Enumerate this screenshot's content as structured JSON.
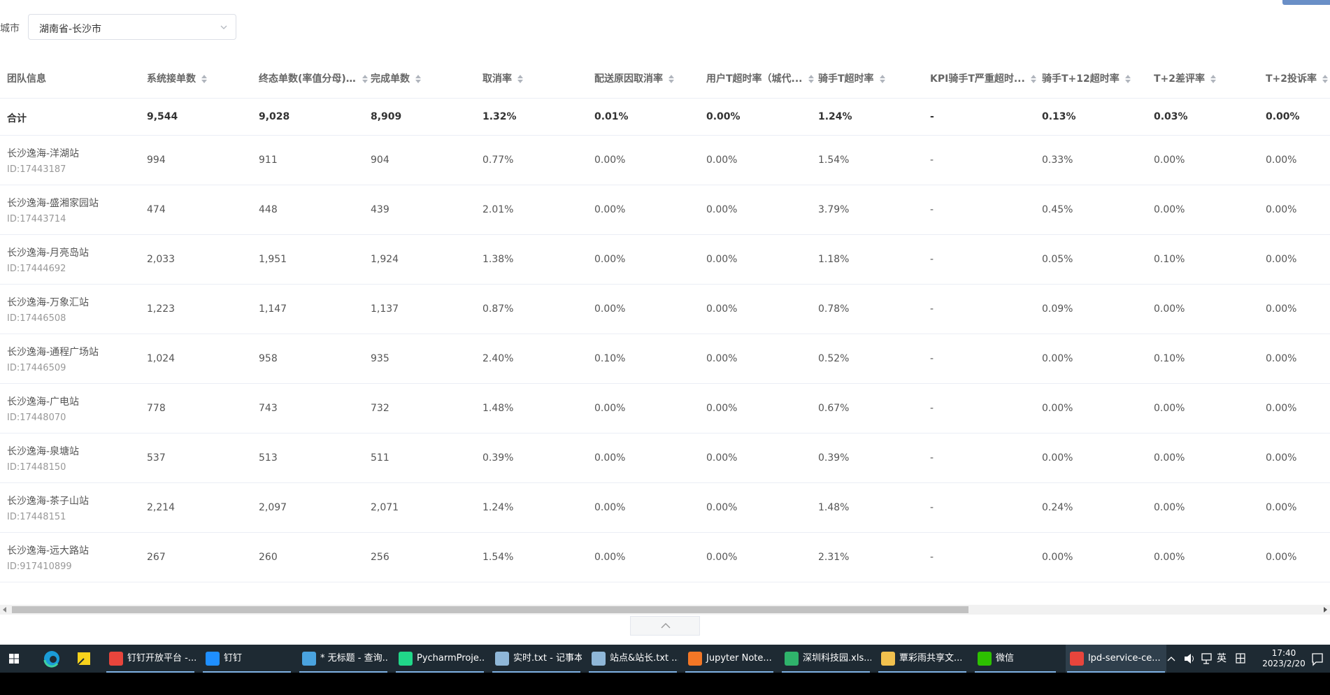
{
  "filter": {
    "label": "城市",
    "value": "湖南省-长沙市"
  },
  "table": {
    "columns": [
      {
        "label": "团队信息",
        "sortable": false
      },
      {
        "label": "系统接单数",
        "sortable": true
      },
      {
        "label": "终态单数(率值分母)...",
        "sortable": true
      },
      {
        "label": "完成单数",
        "sortable": true
      },
      {
        "label": "取消率",
        "sortable": true
      },
      {
        "label": "配送原因取消率",
        "sortable": true
      },
      {
        "label": "用户T超时率（城代...",
        "sortable": true
      },
      {
        "label": "骑手T超时率",
        "sortable": true
      },
      {
        "label": "KPI骑手T严重超时...",
        "sortable": true
      },
      {
        "label": "骑手T+12超时率",
        "sortable": true
      },
      {
        "label": "T+2差评率",
        "sortable": true
      },
      {
        "label": "T+2投诉率",
        "sortable": true
      }
    ],
    "total": [
      "合计",
      "9,544",
      "9,028",
      "8,909",
      "1.32%",
      "0.01%",
      "0.00%",
      "1.24%",
      "-",
      "0.13%",
      "0.03%",
      "0.00%"
    ],
    "rows": [
      {
        "name": "长沙逸海-洋湖站",
        "id": "ID:17443187",
        "values": [
          "994",
          "911",
          "904",
          "0.77%",
          "0.00%",
          "0.00%",
          "1.54%",
          "-",
          "0.33%",
          "0.00%",
          "0.00%"
        ]
      },
      {
        "name": "长沙逸海-盛湘家园站",
        "id": "ID:17443714",
        "values": [
          "474",
          "448",
          "439",
          "2.01%",
          "0.00%",
          "0.00%",
          "3.79%",
          "-",
          "0.45%",
          "0.00%",
          "0.00%"
        ]
      },
      {
        "name": "长沙逸海-月亮岛站",
        "id": "ID:17444692",
        "values": [
          "2,033",
          "1,951",
          "1,924",
          "1.38%",
          "0.00%",
          "0.00%",
          "1.18%",
          "-",
          "0.05%",
          "0.10%",
          "0.00%"
        ]
      },
      {
        "name": "长沙逸海-万象汇站",
        "id": "ID:17446508",
        "values": [
          "1,223",
          "1,147",
          "1,137",
          "0.87%",
          "0.00%",
          "0.00%",
          "0.78%",
          "-",
          "0.09%",
          "0.00%",
          "0.00%"
        ]
      },
      {
        "name": "长沙逸海-通程广场站",
        "id": "ID:17446509",
        "values": [
          "1,024",
          "958",
          "935",
          "2.40%",
          "0.10%",
          "0.00%",
          "0.52%",
          "-",
          "0.00%",
          "0.10%",
          "0.00%"
        ]
      },
      {
        "name": "长沙逸海-广电站",
        "id": "ID:17448070",
        "values": [
          "778",
          "743",
          "732",
          "1.48%",
          "0.00%",
          "0.00%",
          "0.67%",
          "-",
          "0.00%",
          "0.00%",
          "0.00%"
        ]
      },
      {
        "name": "长沙逸海-泉塘站",
        "id": "ID:17448150",
        "values": [
          "537",
          "513",
          "511",
          "0.39%",
          "0.00%",
          "0.00%",
          "0.39%",
          "-",
          "0.00%",
          "0.00%",
          "0.00%"
        ]
      },
      {
        "name": "长沙逸海-茶子山站",
        "id": "ID:17448151",
        "values": [
          "2,214",
          "2,097",
          "2,071",
          "1.24%",
          "0.00%",
          "0.00%",
          "1.48%",
          "-",
          "0.24%",
          "0.00%",
          "0.00%"
        ]
      },
      {
        "name": "长沙逸海-远大路站",
        "id": "ID:917410899",
        "values": [
          "267",
          "260",
          "256",
          "1.54%",
          "0.00%",
          "0.00%",
          "2.31%",
          "-",
          "0.00%",
          "0.00%",
          "0.00%"
        ]
      }
    ]
  },
  "taskbar": {
    "items": [
      {
        "label": "钉钉开放平台 -...",
        "icon": "chrome-icon",
        "color": "#e8453c"
      },
      {
        "label": "钉钉",
        "icon": "dingtalk-icon",
        "color": "#1f8fff"
      },
      {
        "label": "* 无标题 - 查询...",
        "icon": "query-icon",
        "color": "#4aa3df"
      },
      {
        "label": "PycharmProje...",
        "icon": "pycharm-icon",
        "color": "#21d789"
      },
      {
        "label": "实时.txt - 记事本",
        "icon": "notepad-icon",
        "color": "#8fb7d8"
      },
      {
        "label": "站点&站长.txt ...",
        "icon": "notepad-icon",
        "color": "#8fb7d8"
      },
      {
        "label": "Jupyter Note...",
        "icon": "jupyter-icon",
        "color": "#f37726"
      },
      {
        "label": "深圳科技园.xls...",
        "icon": "spreadsheet-icon",
        "color": "#2fb36b"
      },
      {
        "label": "覃彩雨共享文...",
        "icon": "folder-icon",
        "color": "#f2c14e"
      },
      {
        "label": "微信",
        "icon": "wechat-icon",
        "color": "#2dc100"
      },
      {
        "label": "lpd-service-ce...",
        "icon": "chrome-icon",
        "color": "#e8453c"
      }
    ],
    "tray": {
      "ime": "英",
      "time": "17:40",
      "date": "2023/2/20"
    }
  }
}
